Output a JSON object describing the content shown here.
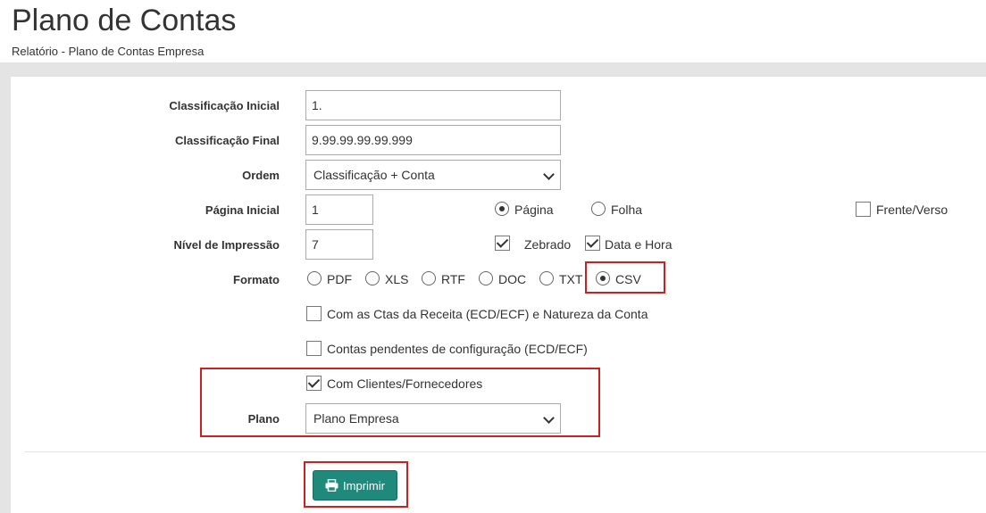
{
  "header": {
    "title": "Plano de Contas",
    "subtitle": "Relatório - Plano de Contas Empresa"
  },
  "form": {
    "classificacao_inicial": {
      "label": "Classificação Inicial",
      "value": "1."
    },
    "classificacao_final": {
      "label": "Classificação Final",
      "value": "9.99.99.99.99.999"
    },
    "ordem": {
      "label": "Ordem",
      "selected": "Classificação + Conta"
    },
    "pagina_inicial": {
      "label": "Página Inicial",
      "value": "1"
    },
    "numeracao": {
      "pagina": "Página",
      "folha": "Folha",
      "selected": "Página"
    },
    "frente_verso": {
      "label": "Frente/Verso",
      "checked": false
    },
    "nivel_impressao": {
      "label": "Nível de Impressão",
      "value": "7"
    },
    "zebrado": {
      "label": "Zebrado",
      "checked": true
    },
    "data_hora": {
      "label": "Data e Hora",
      "checked": true
    },
    "formato": {
      "label": "Formato",
      "options": [
        "PDF",
        "XLS",
        "RTF",
        "DOC",
        "TXT",
        "CSV"
      ],
      "selected": "CSV"
    },
    "ctas_receita": {
      "label": "Com as Ctas da Receita (ECD/ECF) e Natureza da Conta",
      "checked": false
    },
    "contas_pendentes": {
      "label": "Contas pendentes de configuração (ECD/ECF)",
      "checked": false
    },
    "clientes_fornecedores": {
      "label": "Com Clientes/Fornecedores",
      "checked": true
    },
    "plano": {
      "label": "Plano",
      "selected": "Plano Empresa"
    }
  },
  "actions": {
    "imprimir": "Imprimir"
  },
  "colors": {
    "button": "#1f8a7c",
    "highlight": "#cc1f1f"
  }
}
